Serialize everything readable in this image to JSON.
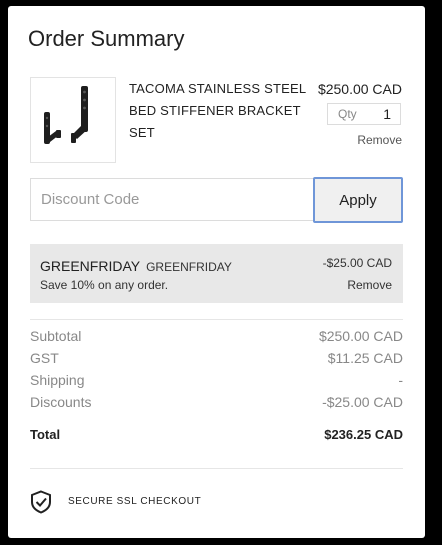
{
  "order_summary": {
    "title": "Order Summary",
    "item": {
      "name": "TACOMA STAINLESS STEEL BED STIFFENER BRACKET SET",
      "price": "$250.00 CAD",
      "qty_label": "Qty",
      "qty_value": "1",
      "remove_label": "Remove"
    },
    "discount": {
      "placeholder": "Discount Code",
      "apply_label": "Apply"
    },
    "promo": {
      "code": "GREENFRIDAY",
      "code_secondary": "GREENFRIDAY",
      "description": "Save 10% on any order.",
      "amount": "-$25.00 CAD",
      "remove_label": "Remove"
    },
    "totals": {
      "subtotal_label": "Subtotal",
      "subtotal_value": "$250.00 CAD",
      "gst_label": "GST",
      "gst_value": "$11.25 CAD",
      "shipping_label": "Shipping",
      "shipping_value": "-",
      "discounts_label": "Discounts",
      "discounts_value": "-$25.00 CAD",
      "total_label": "Total",
      "total_value": "$236.25 CAD"
    },
    "security": {
      "label": "SECURE SSL CHECKOUT",
      "icon": "shield-check-icon"
    }
  }
}
